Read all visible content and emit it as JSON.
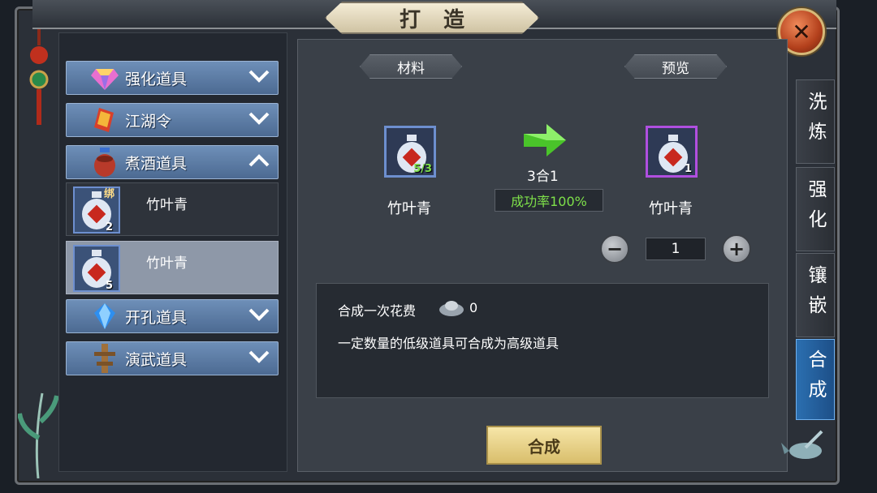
{
  "title": "打造",
  "close_icon": "close-icon",
  "categories": [
    {
      "label": "强化道具",
      "icon": "gem-icon",
      "state": "collapsed"
    },
    {
      "label": "江湖令",
      "icon": "token-icon",
      "state": "collapsed"
    },
    {
      "label": "煮酒道具",
      "icon": "wine-jar-icon",
      "state": "expanded"
    },
    {
      "label": "开孔道具",
      "icon": "blue-crystal-icon",
      "state": "collapsed"
    },
    {
      "label": "演武道具",
      "icon": "wooden-dummy-icon",
      "state": "collapsed"
    }
  ],
  "sub_items": [
    {
      "name": "竹叶青",
      "count": "2",
      "bound_tag": "绑"
    },
    {
      "name": "竹叶青",
      "count": "5",
      "bound_tag": ""
    }
  ],
  "material": {
    "header": "材料",
    "name": "竹叶青",
    "count": "5/3"
  },
  "preview": {
    "header": "预览",
    "name": "竹叶青",
    "count": "1"
  },
  "ratio": "3合1",
  "success_rate": "成功率100%",
  "quantity": "1",
  "cost_label": "合成一次花费",
  "cost_value": "0",
  "description": "一定数量的低级道具可合成为高级道具",
  "combine_button": "合成",
  "side_tabs": [
    {
      "label": "洗炼",
      "active": false
    },
    {
      "label": "强化",
      "active": false
    },
    {
      "label": "镶嵌",
      "active": false
    },
    {
      "label": "合成",
      "active": true
    }
  ],
  "colors": {
    "material_border": "#6d8fcf",
    "preview_border": "#b04fe0",
    "accent_green": "#7ee04a",
    "active_tab": "#2b6fb0"
  }
}
